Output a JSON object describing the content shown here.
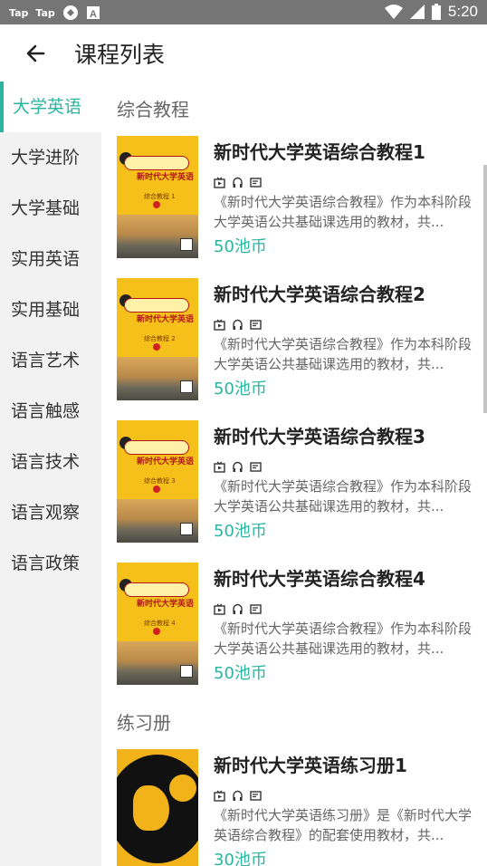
{
  "status_bar": {
    "app_icons": [
      "Tap",
      "Tap"
    ],
    "time": "5:20"
  },
  "header": {
    "title": "课程列表",
    "back_icon": "arrow-left-icon"
  },
  "colors": {
    "accent": "#2bb5a0"
  },
  "sidebar": {
    "items": [
      {
        "label": "大学英语",
        "active": true
      },
      {
        "label": "大学进阶"
      },
      {
        "label": "大学基础"
      },
      {
        "label": "实用英语"
      },
      {
        "label": "实用基础"
      },
      {
        "label": "语言艺术"
      },
      {
        "label": "语言触感"
      },
      {
        "label": "语言技术"
      },
      {
        "label": "语言观察"
      },
      {
        "label": "语言政策"
      }
    ]
  },
  "sections": [
    {
      "title": "综合教程",
      "courses": [
        {
          "name": "新时代大学英语综合教程1",
          "desc": "《新时代大学英语综合教程》作为本科阶段大学英语公共基础课选用的教材，共...",
          "price": "50池币",
          "cover_title": "新时代大学英语",
          "cover_sub": "综合教程 1"
        },
        {
          "name": "新时代大学英语综合教程2",
          "desc": "《新时代大学英语综合教程》作为本科阶段大学英语公共基础课选用的教材，共...",
          "price": "50池币",
          "cover_title": "新时代大学英语",
          "cover_sub": "综合教程 2"
        },
        {
          "name": "新时代大学英语综合教程3",
          "desc": "《新时代大学英语综合教程》作为本科阶段大学英语公共基础课选用的教材，共...",
          "price": "50池币",
          "cover_title": "新时代大学英语",
          "cover_sub": "综合教程 3"
        },
        {
          "name": "新时代大学英语综合教程4",
          "desc": "《新时代大学英语综合教程》作为本科阶段大学英语公共基础课选用的教材，共...",
          "price": "50池币",
          "cover_title": "新时代大学英语",
          "cover_sub": "综合教程 4"
        }
      ]
    },
    {
      "title": "练习册",
      "courses": [
        {
          "name": "新时代大学英语练习册1",
          "desc": "《新时代大学英语练习册》是《新时代大学英语综合教程》的配套使用教材，共...",
          "price": "30池币"
        }
      ]
    }
  ]
}
